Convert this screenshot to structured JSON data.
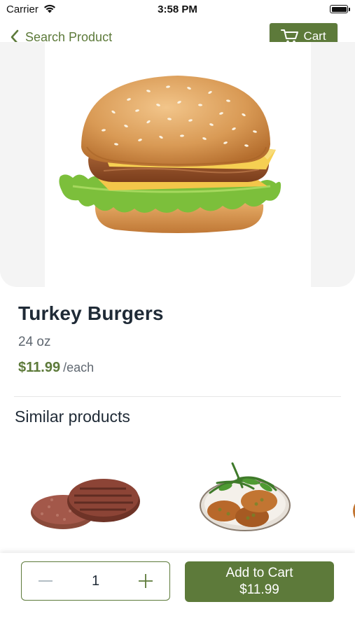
{
  "status_bar": {
    "carrier": "Carrier",
    "time": "3:58 PM"
  },
  "header": {
    "back_label": "Search Product",
    "cart_label": "Cart"
  },
  "product": {
    "name": "Turkey Burgers",
    "size": "24 oz",
    "price": "$11.99",
    "unit": "/each"
  },
  "similar": {
    "heading": "Similar products"
  },
  "bottom": {
    "quantity": "1",
    "add_label": "Add to Cart",
    "add_price": "$11.99"
  },
  "colors": {
    "accent": "#5d7a3a",
    "text": "#1f2a36",
    "muted": "#5f6770"
  },
  "icons": [
    "wifi-icon",
    "battery-icon",
    "chevron-left-icon",
    "cart-icon",
    "minus-icon",
    "plus-icon"
  ]
}
